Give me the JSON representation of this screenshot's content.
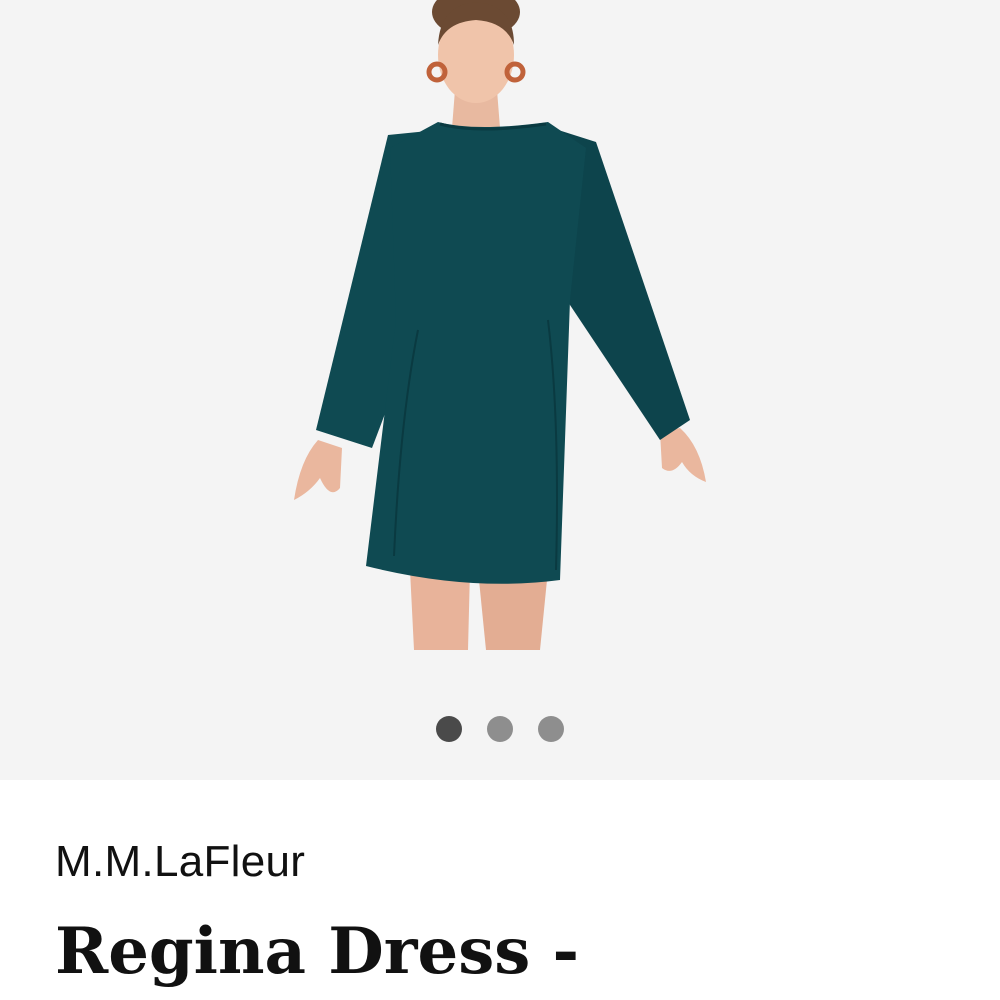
{
  "gallery": {
    "image_alt": "Model wearing a teal long-sleeve shift dress",
    "dress_color": "#0f4a52",
    "background_color": "#f4f4f4",
    "dots": [
      {
        "label": "Image 1",
        "active": true
      },
      {
        "label": "Image 2",
        "active": false
      },
      {
        "label": "Image 3",
        "active": false
      }
    ]
  },
  "product": {
    "brand": "M.M.LaFleur",
    "title": "Regina Dress -"
  }
}
